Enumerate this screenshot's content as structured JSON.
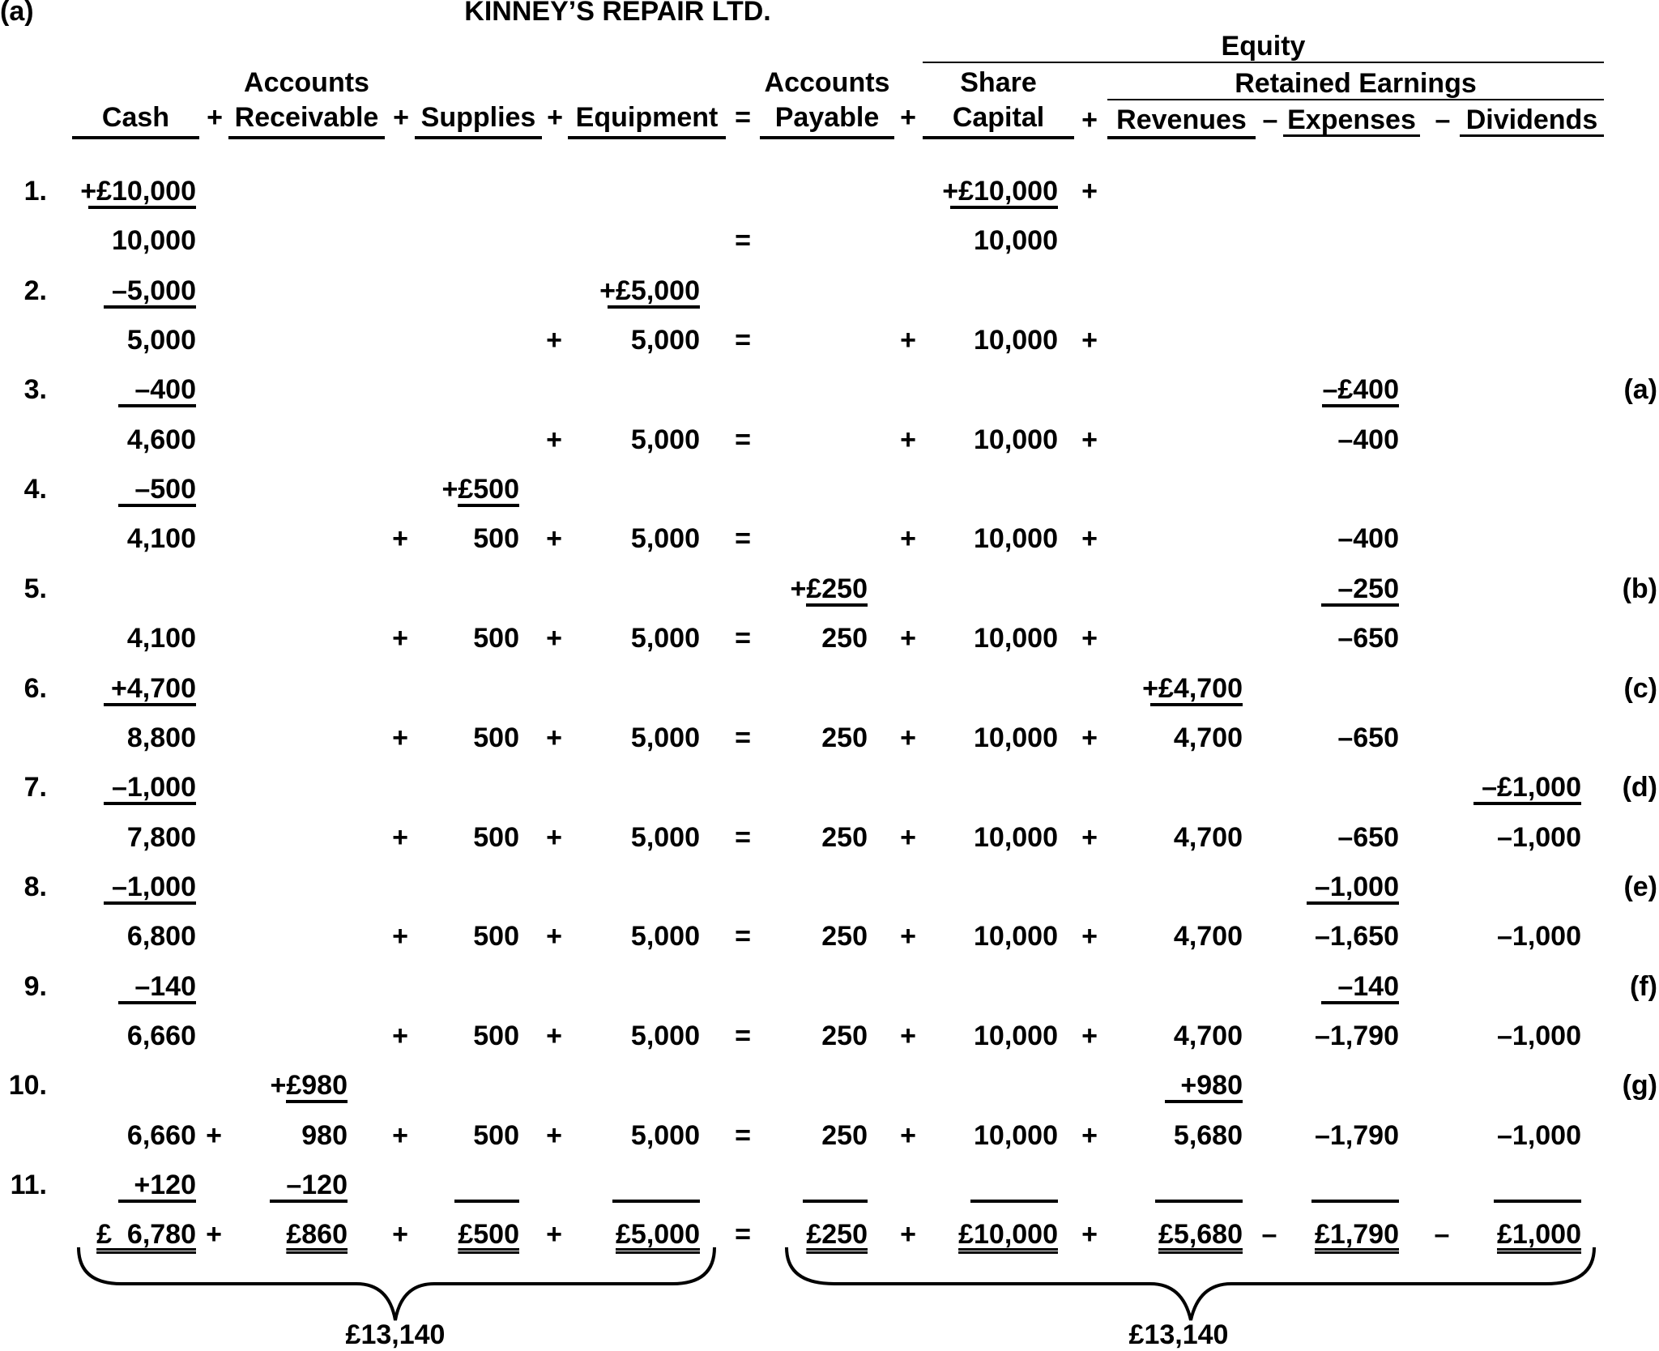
{
  "part_label": "(a)",
  "title": "KINNEY’S REPAIR LTD.",
  "headers": {
    "equity": "Equity",
    "retained_earnings": "Retained Earnings",
    "cash": "Cash",
    "ar_top": "Accounts",
    "ar_bottom": "Receivable",
    "supplies": "Supplies",
    "equipment": "Equipment",
    "ap_top": "Accounts",
    "ap_bottom": "Payable",
    "sc_top": "Share",
    "sc_bottom": "Capital",
    "revenues": "Revenues",
    "expenses": "Expenses",
    "dividends": "Dividends",
    "op_plus": "+",
    "op_equals": "=",
    "op_minus": "–"
  },
  "rows": [
    {
      "label": "1.",
      "kind": "txn",
      "cash": {
        "pre": "+",
        "v": "£10,000",
        "u": true
      },
      "sc": {
        "pre": "+",
        "v": "£10,000",
        "u": true
      },
      "ops": {
        "sc_rev": "+"
      }
    },
    {
      "label": "",
      "kind": "bal",
      "cash": {
        "v": "10,000"
      },
      "sc": {
        "v": "10,000"
      },
      "ops": {
        "eq": "="
      }
    },
    {
      "label": "2.",
      "kind": "txn",
      "cash": {
        "v": "–5,000",
        "u": true
      },
      "eqp": {
        "pre": "+",
        "v": "£5,000",
        "u": true
      }
    },
    {
      "label": "",
      "kind": "bal",
      "cash": {
        "v": "5,000"
      },
      "eqp": {
        "v": "5,000"
      },
      "sc": {
        "v": "10,000"
      },
      "ops": {
        "sup_eqp": "+",
        "eq": "=",
        "ap_sc": "+",
        "sc_rev": "+"
      }
    },
    {
      "label": "3.",
      "kind": "txn",
      "cash": {
        "v": "–400",
        "u": true
      },
      "exp": {
        "v": "–£400",
        "u": true
      },
      "note": "(a)"
    },
    {
      "label": "",
      "kind": "bal",
      "cash": {
        "v": "4,600"
      },
      "eqp": {
        "v": "5,000"
      },
      "sc": {
        "v": "10,000"
      },
      "exp": {
        "v": "–400"
      },
      "ops": {
        "sup_eqp": "+",
        "eq": "=",
        "ap_sc": "+",
        "sc_rev": "+"
      }
    },
    {
      "label": "4.",
      "kind": "txn",
      "cash": {
        "v": "–500",
        "u": true
      },
      "sup": {
        "pre": "+",
        "v": "£500",
        "u": true
      }
    },
    {
      "label": "",
      "kind": "bal",
      "cash": {
        "v": "4,100"
      },
      "sup": {
        "v": "500"
      },
      "eqp": {
        "v": "5,000"
      },
      "sc": {
        "v": "10,000"
      },
      "exp": {
        "v": "–400"
      },
      "ops": {
        "ar_sup": "+",
        "sup_eqp": "+",
        "eq": "=",
        "ap_sc": "+",
        "sc_rev": "+"
      }
    },
    {
      "label": "5.",
      "kind": "txn",
      "ap": {
        "pre": "+",
        "v": "£250",
        "u": true
      },
      "exp": {
        "v": "–250",
        "u": true
      },
      "note": "(b)"
    },
    {
      "label": "",
      "kind": "bal",
      "cash": {
        "v": "4,100"
      },
      "sup": {
        "v": "500"
      },
      "eqp": {
        "v": "5,000"
      },
      "ap": {
        "v": "250"
      },
      "sc": {
        "v": "10,000"
      },
      "exp": {
        "v": "–650"
      },
      "ops": {
        "ar_sup": "+",
        "sup_eqp": "+",
        "eq": "=",
        "ap_sc": "+",
        "sc_rev": "+"
      }
    },
    {
      "label": "6.",
      "kind": "txn",
      "cash": {
        "v": "+4,700",
        "u": true
      },
      "rev": {
        "pre": "+",
        "v": "£4,700",
        "u": true
      },
      "note": "(c)"
    },
    {
      "label": "",
      "kind": "bal",
      "cash": {
        "v": "8,800"
      },
      "sup": {
        "v": "500"
      },
      "eqp": {
        "v": "5,000"
      },
      "ap": {
        "v": "250"
      },
      "sc": {
        "v": "10,000"
      },
      "rev": {
        "v": "4,700"
      },
      "exp": {
        "v": "–650"
      },
      "ops": {
        "ar_sup": "+",
        "sup_eqp": "+",
        "eq": "=",
        "ap_sc": "+",
        "sc_rev": "+"
      }
    },
    {
      "label": "7.",
      "kind": "txn",
      "cash": {
        "v": "–1,000",
        "u": true
      },
      "div": {
        "v": "–£1,000",
        "u": true
      },
      "note": "(d)"
    },
    {
      "label": "",
      "kind": "bal",
      "cash": {
        "v": "7,800"
      },
      "sup": {
        "v": "500"
      },
      "eqp": {
        "v": "5,000"
      },
      "ap": {
        "v": "250"
      },
      "sc": {
        "v": "10,000"
      },
      "rev": {
        "v": "4,700"
      },
      "exp": {
        "v": "–650"
      },
      "div": {
        "v": "–1,000"
      },
      "ops": {
        "ar_sup": "+",
        "sup_eqp": "+",
        "eq": "=",
        "ap_sc": "+",
        "sc_rev": "+"
      }
    },
    {
      "label": "8.",
      "kind": "txn",
      "cash": {
        "v": "–1,000",
        "u": true
      },
      "exp": {
        "v": "–1,000",
        "u": true
      },
      "note": "(e)"
    },
    {
      "label": "",
      "kind": "bal",
      "cash": {
        "v": "6,800"
      },
      "sup": {
        "v": "500"
      },
      "eqp": {
        "v": "5,000"
      },
      "ap": {
        "v": "250"
      },
      "sc": {
        "v": "10,000"
      },
      "rev": {
        "v": "4,700"
      },
      "exp": {
        "v": "–1,650"
      },
      "div": {
        "v": "–1,000"
      },
      "ops": {
        "ar_sup": "+",
        "sup_eqp": "+",
        "eq": "=",
        "ap_sc": "+",
        "sc_rev": "+"
      }
    },
    {
      "label": "9.",
      "kind": "txn",
      "cash": {
        "v": "–140",
        "u": true
      },
      "exp": {
        "v": "–140",
        "u": true
      },
      "note": "(f)"
    },
    {
      "label": "",
      "kind": "bal",
      "cash": {
        "v": "6,660"
      },
      "sup": {
        "v": "500"
      },
      "eqp": {
        "v": "5,000"
      },
      "ap": {
        "v": "250"
      },
      "sc": {
        "v": "10,000"
      },
      "rev": {
        "v": "4,700"
      },
      "exp": {
        "v": "–1,790"
      },
      "div": {
        "v": "–1,000"
      },
      "ops": {
        "ar_sup": "+",
        "sup_eqp": "+",
        "eq": "=",
        "ap_sc": "+",
        "sc_rev": "+"
      }
    },
    {
      "label": "10.",
      "kind": "txn",
      "ar": {
        "pre": "+",
        "v": "£980",
        "u": true
      },
      "rev": {
        "v": "+980",
        "u": true
      },
      "note": "(g)"
    },
    {
      "label": "",
      "kind": "bal",
      "cash": {
        "v": "6,660"
      },
      "ar": {
        "v": "980"
      },
      "sup": {
        "v": "500"
      },
      "eqp": {
        "v": "5,000"
      },
      "ap": {
        "v": "250"
      },
      "sc": {
        "v": "10,000"
      },
      "rev": {
        "v": "5,680"
      },
      "exp": {
        "v": "–1,790"
      },
      "div": {
        "v": "–1,000"
      },
      "ops": {
        "cash_ar": "+",
        "ar_sup": "+",
        "sup_eqp": "+",
        "eq": "=",
        "ap_sc": "+",
        "sc_rev": "+"
      }
    },
    {
      "label": "11.",
      "kind": "txn_last",
      "cash": {
        "v": "+120",
        "u": true
      },
      "ar": {
        "v": "–120",
        "u": true
      }
    },
    {
      "label": "",
      "kind": "total",
      "cash": {
        "v": "£  6,780"
      },
      "ar": {
        "v": "£860"
      },
      "sup": {
        "v": "£500"
      },
      "eqp": {
        "v": "£5,000"
      },
      "ap": {
        "v": "£250"
      },
      "sc": {
        "v": "£10,000"
      },
      "rev": {
        "v": "£5,680"
      },
      "exp": {
        "v": "£1,790"
      },
      "div": {
        "v": "£1,000"
      },
      "ops": {
        "cash_ar": "+",
        "ar_sup": "+",
        "sup_eqp": "+",
        "eq": "=",
        "ap_sc": "+",
        "sc_rev": "+",
        "rev_exp": "–",
        "exp_div": "–"
      }
    }
  ],
  "totals": {
    "assets": "£13,140",
    "liabilities_equity": "£13,140"
  }
}
